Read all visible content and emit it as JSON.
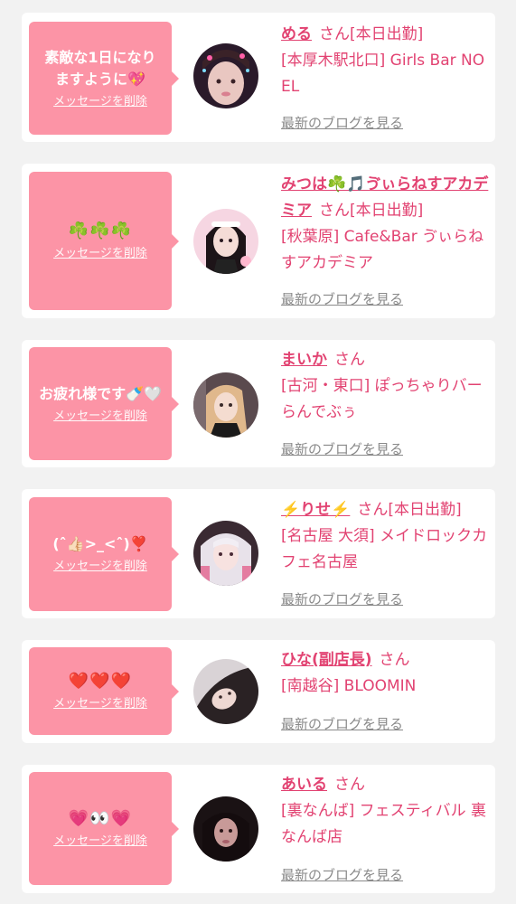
{
  "colors": {
    "page_bg": "#f2f2f2",
    "card_bg": "#ffffff",
    "bubble": "#fc94a6",
    "accent": "#e24372",
    "muted": "#8a8a8a"
  },
  "delete_label": "メッセージを削除",
  "blog_label": "最新のブログを見る",
  "san_label": "さん",
  "cards": [
    {
      "message": "素敵な1日になりますように💖",
      "name": "める",
      "status": "[本日出勤]",
      "shop": "[本厚木駅北口] Girls Bar NOEL"
    },
    {
      "message": "☘️☘️☘️",
      "name": "みつは☘️🎵ゔぃらねすアカデミア",
      "status": "[本日出勤]",
      "shop": "[秋葉原] Cafe&Bar ゔぃらねすアカデミア"
    },
    {
      "message": "お疲れ様です🍼🤍",
      "name": "まいか",
      "status": "",
      "shop": "[古河・東口] ぽっちゃりバー らんでぶぅ"
    },
    {
      "message": "(ˆ👍🏻>_<ˆ)❣️",
      "name": "⚡️りせ⚡️",
      "status": "[本日出勤]",
      "shop": "[名古屋 大須] メイドロックカフェ名古屋"
    },
    {
      "message": "❤️❤️❤️",
      "name": "ひな(副店長)",
      "status": "",
      "shop": "[南越谷] BLOOMIN"
    },
    {
      "message": "💗👀💗",
      "name": "あいる",
      "status": "",
      "shop": "[裏なんば] フェスティバル 裏なんば店"
    }
  ]
}
